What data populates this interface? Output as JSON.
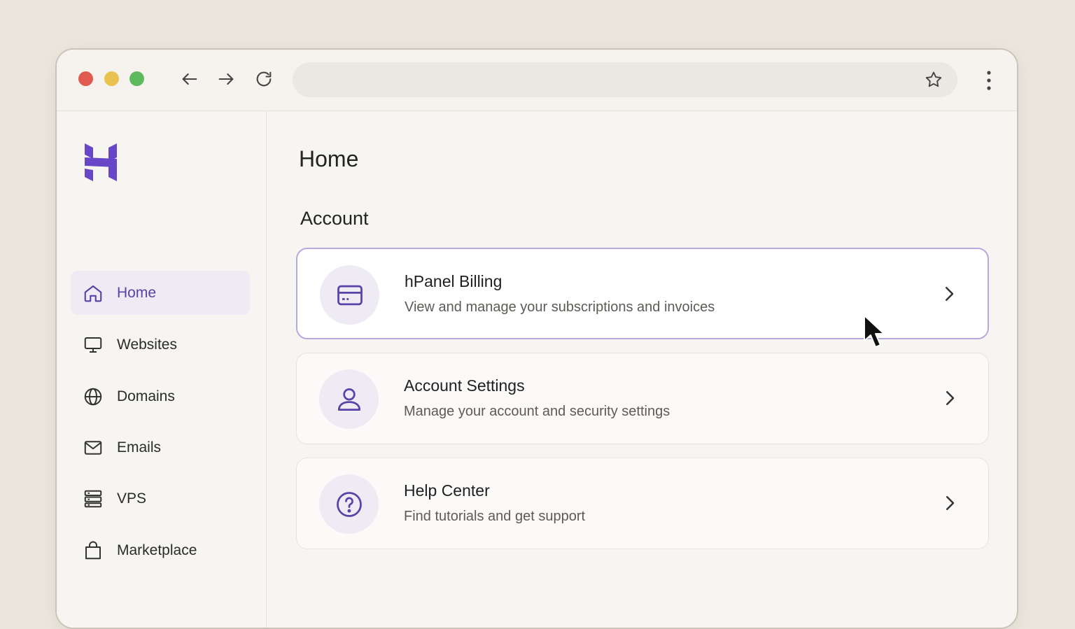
{
  "browser": {
    "traffic_lights": [
      "red",
      "yellow",
      "green"
    ],
    "icons": {
      "back": "arrow-left-icon",
      "forward": "arrow-right-icon",
      "reload": "reload-icon",
      "bookmark": "star-icon",
      "menu": "kebab-menu-icon"
    },
    "address_value": ""
  },
  "sidebar": {
    "logo": "hostinger-logo",
    "items": [
      {
        "label": "Home",
        "icon": "home-icon",
        "active": true
      },
      {
        "label": "Websites",
        "icon": "monitor-icon",
        "active": false
      },
      {
        "label": "Domains",
        "icon": "globe-icon",
        "active": false
      },
      {
        "label": "Emails",
        "icon": "mail-icon",
        "active": false
      },
      {
        "label": "VPS",
        "icon": "server-icon",
        "active": false
      },
      {
        "label": "Marketplace",
        "icon": "shopping-bag-icon",
        "active": false
      }
    ]
  },
  "main": {
    "title": "Home",
    "section_title": "Account",
    "cards": [
      {
        "title": "hPanel Billing",
        "description": "View and manage your subscriptions and invoices",
        "icon": "credit-card-icon",
        "selected": true
      },
      {
        "title": "Account Settings",
        "description": "Manage your account and security settings",
        "icon": "user-icon",
        "selected": false
      },
      {
        "title": "Help Center",
        "description": "Find tutorials and get support",
        "icon": "help-circle-icon",
        "selected": false
      }
    ]
  },
  "colors": {
    "accent": "#5a42a8",
    "active_bg": "#efebf5",
    "selected_border": "#b7a9e0",
    "background": "#ebe6dc"
  }
}
